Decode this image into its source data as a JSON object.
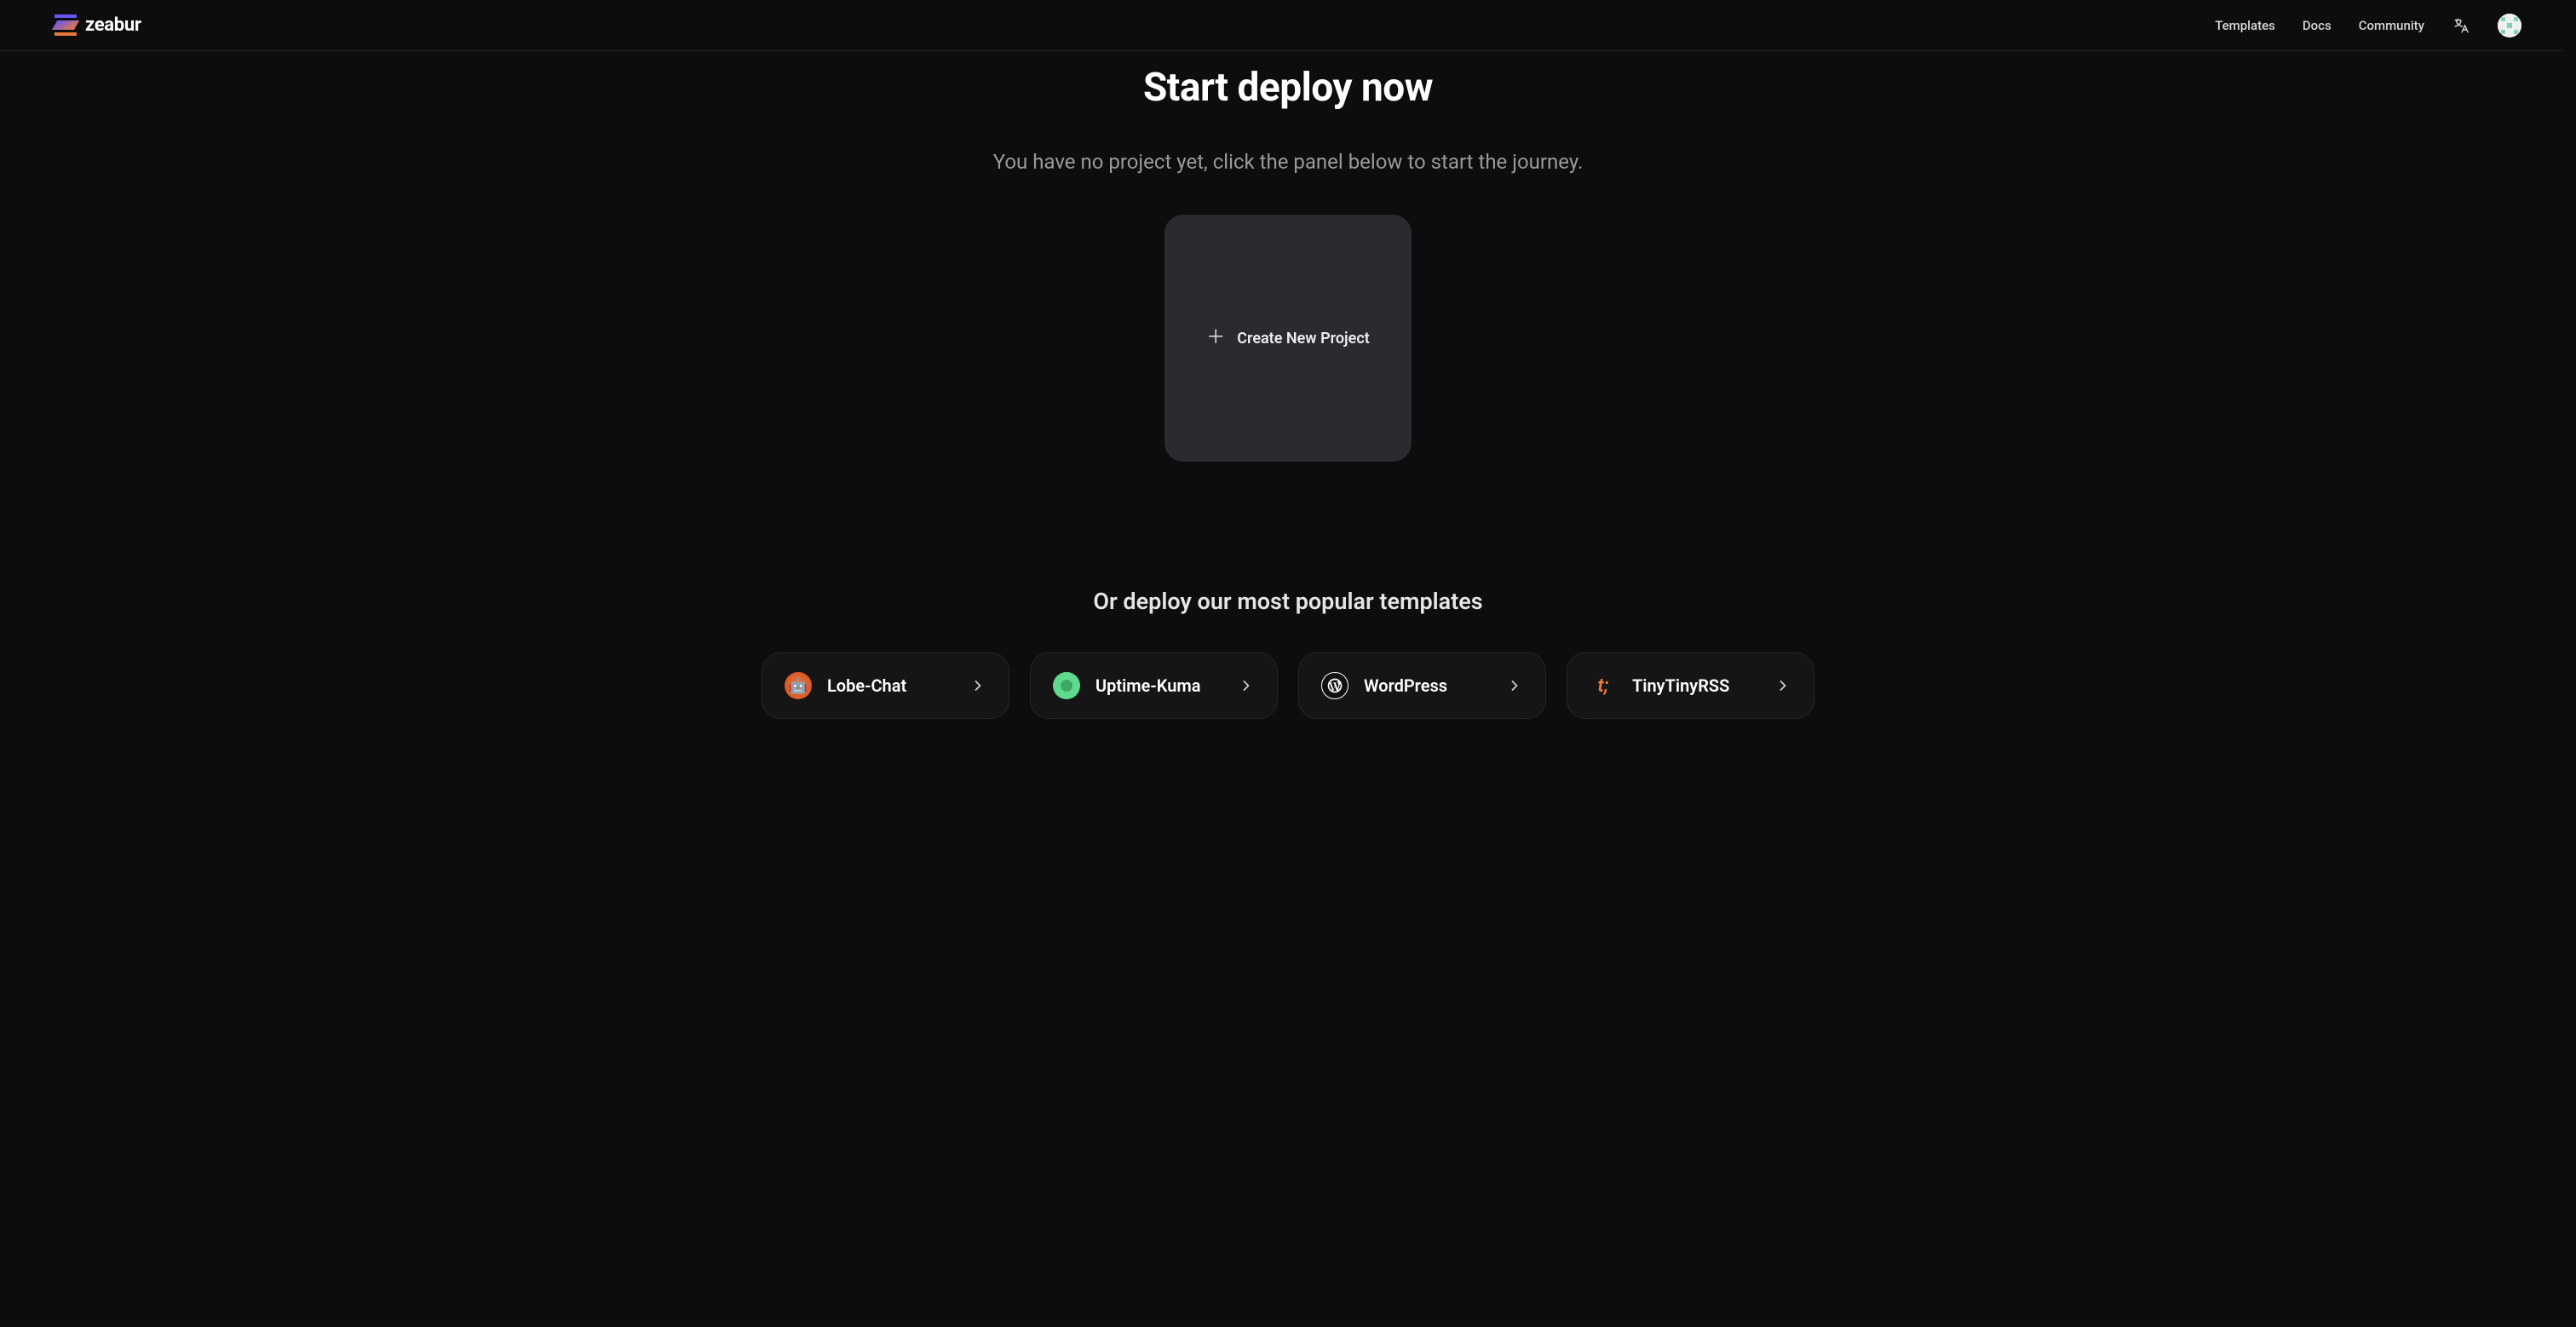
{
  "brand": "zeabur",
  "nav": {
    "templates": "Templates",
    "docs": "Docs",
    "community": "Community"
  },
  "hero": {
    "title": "Start deploy now",
    "subtitle": "You have no project yet, click the panel below to start the journey.",
    "create_label": "Create New Project"
  },
  "templates_section": {
    "heading": "Or deploy our most popular templates",
    "cards": [
      {
        "name": "Lobe-Chat"
      },
      {
        "name": "Uptime-Kuma"
      },
      {
        "name": "WordPress"
      },
      {
        "name": "TinyTinyRSS"
      }
    ]
  }
}
